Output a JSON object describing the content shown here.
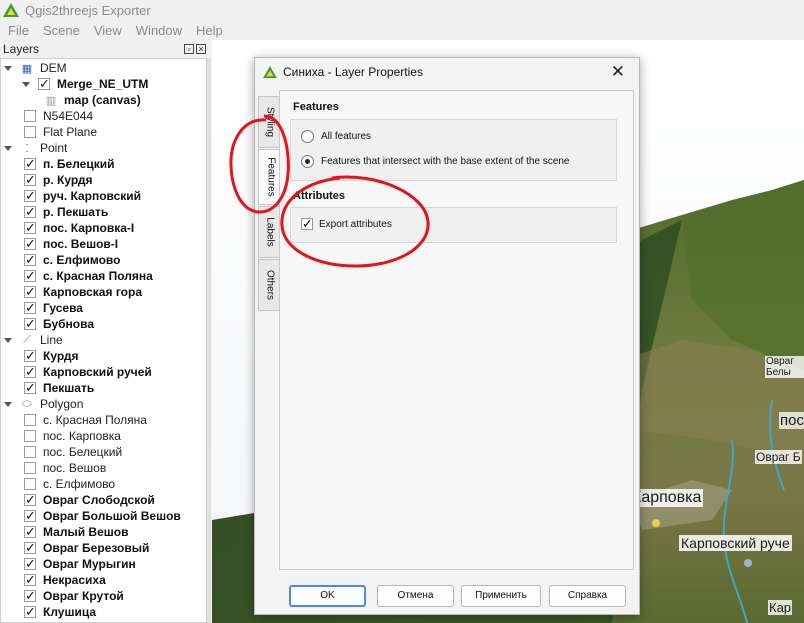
{
  "app": {
    "title": "Qgis2threejs Exporter",
    "brand_color": "#3b9e3b"
  },
  "menu": [
    "File",
    "Scene",
    "View",
    "Window",
    "Help"
  ],
  "layers_panel": {
    "title": "Layers",
    "rows": [
      {
        "type": "group",
        "label": "DEM",
        "icon": "raster-icon",
        "level": 0
      },
      {
        "type": "layer",
        "label": "Merge_NE_UTM",
        "checked": true,
        "bold": true,
        "level": 1,
        "expand": true
      },
      {
        "type": "layer",
        "label": "map (canvas)",
        "icon": "map-canvas-icon",
        "bold": true,
        "level": 2
      },
      {
        "type": "layer",
        "label": "N54E044",
        "checked": false,
        "level": 1
      },
      {
        "type": "layer",
        "label": "Flat Plane",
        "checked": false,
        "level": 1
      },
      {
        "type": "group",
        "label": "Point",
        "icon": "point-icon",
        "level": 0
      },
      {
        "type": "layer",
        "label": "п. Белецкий",
        "checked": true,
        "bold": true,
        "level": 1
      },
      {
        "type": "layer",
        "label": "р. Курдя",
        "checked": true,
        "bold": true,
        "level": 1
      },
      {
        "type": "layer",
        "label": "руч. Карповский",
        "checked": true,
        "bold": true,
        "level": 1
      },
      {
        "type": "layer",
        "label": "р. Пекшать",
        "checked": true,
        "bold": true,
        "level": 1
      },
      {
        "type": "layer",
        "label": "пос. Карповка-I",
        "checked": true,
        "bold": true,
        "level": 1
      },
      {
        "type": "layer",
        "label": "пос. Вешов-I",
        "checked": true,
        "bold": true,
        "level": 1
      },
      {
        "type": "layer",
        "label": "с. Елфимово",
        "checked": true,
        "bold": true,
        "level": 1
      },
      {
        "type": "layer",
        "label": "с. Красная Поляна",
        "checked": true,
        "bold": true,
        "level": 1
      },
      {
        "type": "layer",
        "label": "Карповская гора",
        "checked": true,
        "bold": true,
        "level": 1
      },
      {
        "type": "layer",
        "label": "Гусева",
        "checked": true,
        "bold": true,
        "level": 1
      },
      {
        "type": "layer",
        "label": "Бубнова",
        "checked": true,
        "bold": true,
        "level": 1
      },
      {
        "type": "group",
        "label": "Line",
        "icon": "line-icon",
        "level": 0
      },
      {
        "type": "layer",
        "label": "Курдя",
        "checked": true,
        "bold": true,
        "level": 1
      },
      {
        "type": "layer",
        "label": "Карповский ручей",
        "checked": true,
        "bold": true,
        "level": 1
      },
      {
        "type": "layer",
        "label": "Пекшать",
        "checked": true,
        "bold": true,
        "level": 1
      },
      {
        "type": "group",
        "label": "Polygon",
        "icon": "polygon-icon",
        "level": 0
      },
      {
        "type": "layer",
        "label": "с. Красная Поляна",
        "checked": false,
        "level": 1
      },
      {
        "type": "layer",
        "label": "пос. Карповка",
        "checked": false,
        "level": 1
      },
      {
        "type": "layer",
        "label": "пос. Белецкий",
        "checked": false,
        "level": 1
      },
      {
        "type": "layer",
        "label": "пос. Вешов",
        "checked": false,
        "level": 1
      },
      {
        "type": "layer",
        "label": "с. Елфимово",
        "checked": false,
        "level": 1
      },
      {
        "type": "layer",
        "label": "Овраг Слободской",
        "checked": true,
        "bold": true,
        "level": 1
      },
      {
        "type": "layer",
        "label": "Овраг Большой Вешов",
        "checked": true,
        "bold": true,
        "level": 1
      },
      {
        "type": "layer",
        "label": "Малый Вешов",
        "checked": true,
        "bold": true,
        "level": 1
      },
      {
        "type": "layer",
        "label": "Овраг Березовый",
        "checked": true,
        "bold": true,
        "level": 1
      },
      {
        "type": "layer",
        "label": "Овраг Мурыгин",
        "checked": true,
        "bold": true,
        "level": 1
      },
      {
        "type": "layer",
        "label": "Некрасиха",
        "checked": true,
        "bold": true,
        "level": 1
      },
      {
        "type": "layer",
        "label": "Овраг Крутой",
        "checked": true,
        "bold": true,
        "level": 1
      },
      {
        "type": "layer",
        "label": "Клушица",
        "checked": true,
        "bold": true,
        "level": 1
      }
    ]
  },
  "scene": {
    "labels": {
      "ovrag1": "Овраг Белы",
      "pos1": "пос",
      "ovrag2": "Овраг Б",
      "karpovka": "Карповка",
      "karpovsky": "Карповский руче",
      "kar": "Кар"
    }
  },
  "dialog": {
    "title": "Синиха - Layer Properties",
    "tabs": [
      "Styling",
      "Features",
      "Labels",
      "Others"
    ],
    "active_tab": "Features",
    "features_heading": "Features",
    "options": [
      {
        "label": "All features",
        "selected": false
      },
      {
        "label": "Features that intersect with the base extent of the scene",
        "selected": true
      }
    ],
    "attributes_heading": "Attributes",
    "export_attributes": {
      "label": "Export attributes",
      "checked": true
    },
    "buttons": {
      "ok": "OK",
      "cancel": "Отмена",
      "apply": "Применить",
      "help": "Справка"
    }
  },
  "annotation_color": "#e4141b"
}
